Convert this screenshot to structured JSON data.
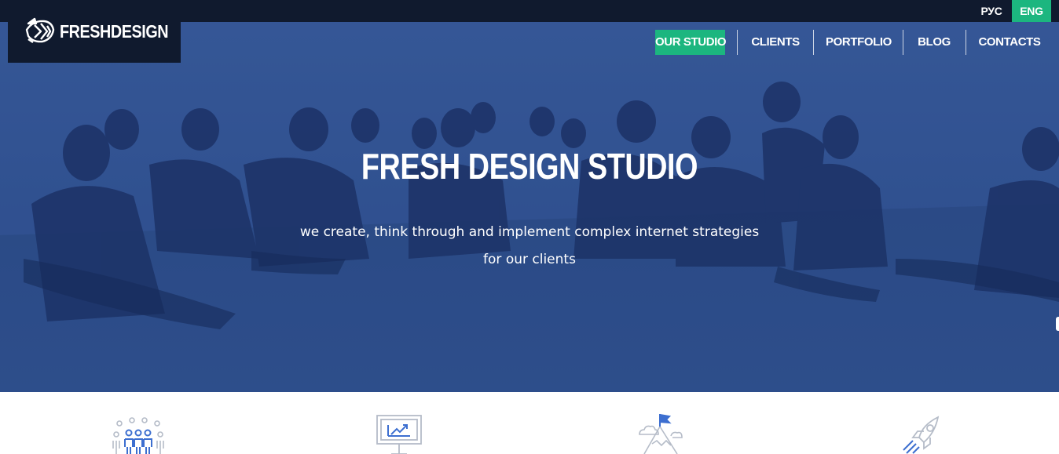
{
  "brand": {
    "name": "FRESHDESIGN",
    "logo_icon": "stylized-fish-logo-icon"
  },
  "languages": {
    "ru": "РУС",
    "en": "ENG",
    "active": "ENG"
  },
  "nav": {
    "items": [
      {
        "label": "OUR STUDIO",
        "active": true
      },
      {
        "label": "CLIENTS",
        "active": false
      },
      {
        "label": "PORTFOLIO",
        "active": false
      },
      {
        "label": "BLOG",
        "active": false
      },
      {
        "label": "CONTACTS",
        "active": false
      }
    ]
  },
  "hero": {
    "title": "FRESH DESIGN STUDIO",
    "subtitle_line1": "we create, think through and implement complex internet strategies",
    "subtitle_line2": "for our clients",
    "background": "team-photo-blue-tint"
  },
  "features": {
    "icons": [
      "team-people-icon",
      "presentation-chart-icon",
      "mountain-flag-icon",
      "rocket-icon"
    ]
  },
  "colors": {
    "accent": "#1cb67f",
    "dark": "#101a2e",
    "hero_tint": "#2a4a86",
    "icon_blue": "#3d6fd0",
    "icon_gray": "#b5bcc8"
  }
}
